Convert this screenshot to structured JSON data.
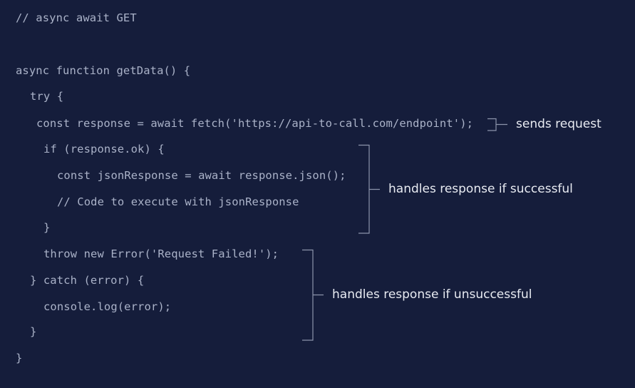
{
  "code": {
    "lines": [
      "// async await GET",
      "async function getData() {",
      "try {",
      "const response = await fetch('https://api-to-call.com/endpoint');",
      "if (response.ok) {",
      "const jsonResponse = await response.json();",
      "// Code to execute with jsonResponse",
      "}",
      "throw new Error('Request Failed!');",
      "} catch (error) {",
      "console.log(error);",
      "}",
      "}"
    ]
  },
  "annotations": {
    "sends_request": "sends request",
    "handles_success": "handles response if successful",
    "handles_failure": "handles response if unsuccessful"
  },
  "colors": {
    "background": "#151d3b",
    "code_text": "#aab2c8",
    "annotation_text": "#e8ebf2",
    "bracket": "#8c94ab"
  }
}
